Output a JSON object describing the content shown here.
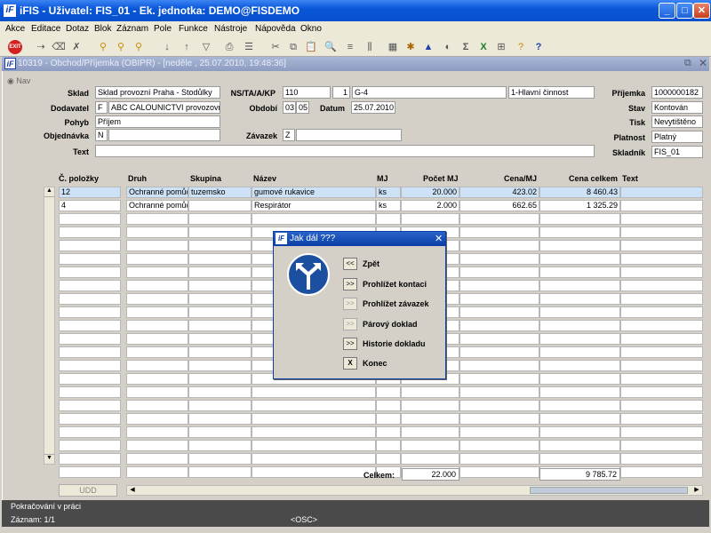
{
  "window": {
    "title": "iFIS - Uživatel: FIS_01 - Ek. jednotka: DEMO@FISDEMO",
    "app_icon": "iF"
  },
  "menu": [
    "Akce",
    "Editace",
    "Dotaz",
    "Blok",
    "Záznam",
    "Pole",
    "Funkce",
    "Nástroje",
    "Nápověda",
    "Okno"
  ],
  "inner_window": {
    "title": "10319 - Obchod/Příjemka (OBIPR) - [neděle , 25.07.2010, 19:48:36]",
    "icon": "iF",
    "nav_label": "Nav"
  },
  "form": {
    "sklad": {
      "label": "Sklad",
      "value": "Sklad provozní Praha - Stodůlky"
    },
    "nstakp": {
      "label": "NS/TA/A/KP",
      "v1": "110",
      "v2": "1",
      "v3": "G-4",
      "v4": "1-Hlavní činnost"
    },
    "prijemka": {
      "label": "Příjemka",
      "value": "1000000182"
    },
    "dodavatel": {
      "label": "Dodavatel",
      "flag": "F",
      "value": "ABC CALOUNICTVI provozovna"
    },
    "obdobi": {
      "label": "Období",
      "v1": "03",
      "v2": "05"
    },
    "datum": {
      "label": "Datum",
      "value": "25.07.2010"
    },
    "stav": {
      "label": "Stav",
      "value": "Kontován"
    },
    "pohyb": {
      "label": "Pohyb",
      "value": "Příjem"
    },
    "tisk": {
      "label": "Tisk",
      "value": "Nevytištěno"
    },
    "objednavka": {
      "label": "Objednávka",
      "flag": "N",
      "value": ""
    },
    "zavazek": {
      "label": "Závazek",
      "flag": "Z",
      "value": ""
    },
    "platnost": {
      "label": "Platnost",
      "value": "Platný"
    },
    "text": {
      "label": "Text",
      "value": ""
    },
    "skladnik": {
      "label": "Skladník",
      "value": "FIS_01"
    }
  },
  "table": {
    "headers": [
      "Č. položky",
      "Druh",
      "Skupina",
      "Název",
      "MJ",
      "Počet MJ",
      "Cena/MJ",
      "Cena celkem",
      "Text"
    ],
    "rows": [
      [
        "12",
        "Ochranné pomůcl",
        "tuzemsko",
        "gumové rukavice",
        "ks",
        "20.000",
        "423.02",
        "8 460.43",
        ""
      ],
      [
        "4",
        "Ochranné pomůcl",
        "",
        "Respirátor",
        "ks",
        "2.000",
        "662.65",
        "1 325.29",
        ""
      ]
    ],
    "empty_rows": 20,
    "total_label": "Celkem:",
    "total_qty": "22.000",
    "total_price": "9 785.72",
    "udd_label": "UDD"
  },
  "dialog": {
    "title": "Jak dál ???",
    "items": [
      {
        "btn": "<<",
        "label": "Zpět",
        "enabled": true
      },
      {
        "btn": ">>",
        "label": "Prohlížet kontaci",
        "enabled": true
      },
      {
        "btn": ">>",
        "label": "Prohlížet závazek",
        "enabled": true
      },
      {
        "btn": ">>",
        "label": "Párový doklad",
        "enabled": false
      },
      {
        "btn": ">>",
        "label": "Historie dokladu",
        "enabled": true
      },
      {
        "btn": "X",
        "label": "Konec",
        "enabled": true
      }
    ]
  },
  "status": {
    "line1": "Pokračování v práci",
    "record": "Záznam: 1/1",
    "osc": "<OSC>"
  },
  "colors": {
    "titlebar": "#0a57d9",
    "selected_row": "#cde2f6",
    "exit_red": "#d42020",
    "sign_blue": "#1c4fa0"
  }
}
